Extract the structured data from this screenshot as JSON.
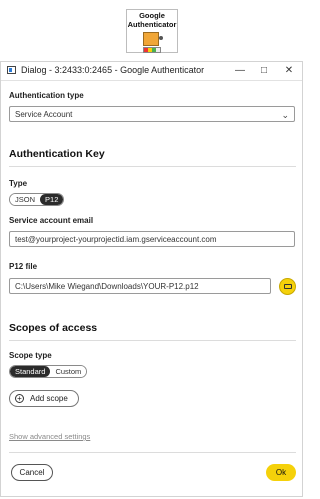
{
  "node": {
    "title_line1": "Google",
    "title_line2": "Authenticator",
    "box_color": "#f0a637"
  },
  "window": {
    "title": "Dialog - 3:2433:0:2465 - Google Authenticator",
    "minimize_icon": "minimize-icon",
    "maximize_icon": "maximize-icon",
    "close_icon": "close-icon"
  },
  "auth_type": {
    "label": "Authentication type",
    "value": "Service Account"
  },
  "auth_key": {
    "section_title": "Authentication Key",
    "type_label": "Type",
    "type_options": [
      "JSON",
      "P12"
    ],
    "type_selected": "P12",
    "email_label": "Service account email",
    "email_value": "test@yourproject-yourprojectid.iam.gserviceaccount.com",
    "p12_label": "P12 file",
    "p12_value": "C:\\Users\\Mike Wiegand\\Downloads\\YOUR-P12.p12"
  },
  "scopes": {
    "section_title": "Scopes of access",
    "scope_type_label": "Scope type",
    "scope_options": [
      "Standard",
      "Custom"
    ],
    "scope_selected": "Standard",
    "add_scope_label": "Add scope"
  },
  "advanced_link": "Show advanced settings",
  "footer": {
    "cancel_label": "Cancel",
    "ok_label": "Ok",
    "accent_color": "#f5d10a"
  }
}
